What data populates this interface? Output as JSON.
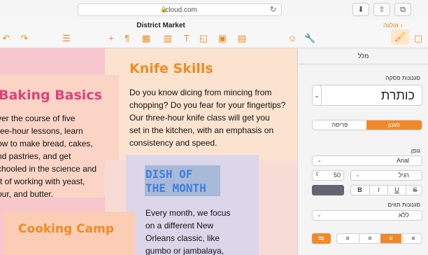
{
  "browser": {
    "url": "icloud.com",
    "toolbar_icons": [
      "lock-icon",
      "reload-icon",
      "download-icon",
      "share-icon",
      "tabs-icon"
    ]
  },
  "app": {
    "document_title": "District Market",
    "back_label": "אולגה",
    "toolbar_icons": [
      "undo-icon",
      "redo-icon",
      "list-icon",
      "insert-icon",
      "paragraph-icon",
      "table-icon",
      "chart-icon",
      "text-icon",
      "shape-icon",
      "media-icon",
      "comment-icon",
      "collaborate-icon",
      "wrench-icon",
      "format-brush-icon",
      "sidebar-toggle-icon"
    ]
  },
  "canvas": {
    "sections": [
      {
        "heading": "Baking Basics",
        "body": [
          "ver the course of five",
          "ree-hour lessons, learn",
          "ow to make bread, cakes,",
          "nd pastries, and get",
          "chooled in the science and",
          "rt of working with yeast,",
          "our, and butter."
        ]
      },
      {
        "heading": "Knife Skills",
        "body": [
          "Do you know dicing from mincing from",
          "chopping? Do you fear for your fingertips?",
          "Our three-hour knife class will get you",
          "set in the kitchen, with an emphasis on",
          "consistency and speed."
        ]
      },
      {
        "heading_lines": [
          "DISH OF",
          "THE MONTH"
        ],
        "body": [
          "Every month, we focus",
          "on a different New",
          "Orleans classic, like",
          "gumbo or jambalaya,"
        ]
      },
      {
        "heading": "Cooking Camp"
      }
    ]
  },
  "inspector": {
    "tab": "מלל",
    "paragraph_styles_label": "סגנונות פסקה",
    "paragraph_style": "כותרת",
    "segments": [
      "סגנון",
      "פריסה"
    ],
    "active_segment": "סגנון",
    "font_label": "גופן",
    "font_name": "Arial",
    "font_weight": "רגיל",
    "font_size": "50",
    "text_buttons": [
      "B",
      "I",
      "U",
      "S"
    ],
    "char_styles_label": "סגנונות תווים",
    "char_style": "ללא"
  },
  "colors": {
    "accent": "#f0892a",
    "heading_pink": "#e0427a",
    "heading_orange": "#f08c22",
    "dish_blue": "#3f7ee0",
    "panel_pink": "#f8c7ce",
    "panel_peach": "#fbe3cf",
    "panel_lavender": "#dcd6ea"
  }
}
